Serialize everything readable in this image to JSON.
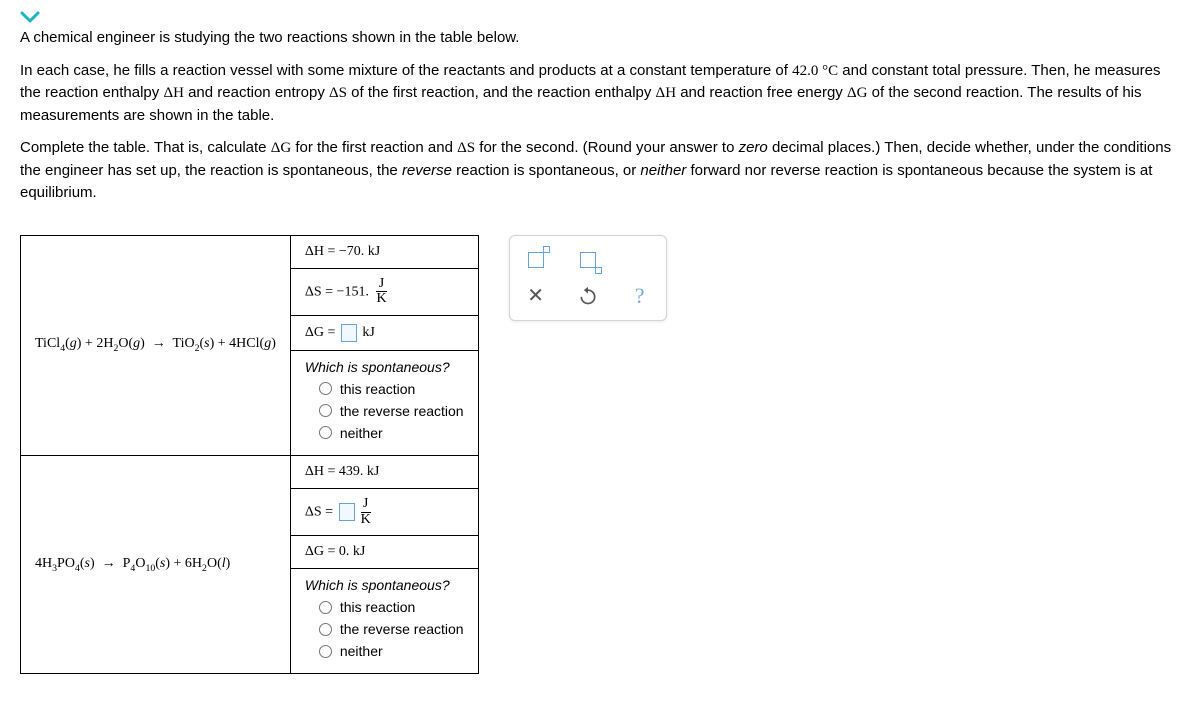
{
  "intro": {
    "line1_a": "A chemical engineer is studying the two reactions shown in the table below.",
    "line2_a": "In each case, he fills a reaction vessel with some mixture of the reactants and products at a constant temperature of ",
    "line2_temp": "42.0 °C",
    "line2_b": " and constant total pressure. Then, he measures the reaction enthalpy ",
    "dH": "ΔH",
    "line2_c": " and reaction entropy ",
    "dS": "ΔS",
    "line2_d": " of the first reaction, and the reaction enthalpy ",
    "line2_e": " and reaction free energy ",
    "dG": "ΔG",
    "line2_f": " of the second reaction. The results of his measurements are shown in the table.",
    "line3_a": "Complete the table. That is, calculate ",
    "line3_b": " for the first reaction and ",
    "line3_c": " for the second. (Round your answer to ",
    "zero": "zero",
    "line3_d": " decimal places.) Then, decide whether, under the conditions the engineer has set up, the reaction is spontaneous, the ",
    "reverse": "reverse",
    "line3_e": " reaction is spontaneous, or ",
    "neither": "neither",
    "line3_f": " forward nor reverse reaction is spontaneous because the system is at equilibrium."
  },
  "table": {
    "r1": {
      "dH_label": "ΔH",
      "dH_eq": " = −70. kJ",
      "dS_label": "ΔS",
      "dS_eq": " = −151. ",
      "frac_num": "J",
      "frac_den": "K",
      "dG_label": "ΔG",
      "dG_eq_pre": " = ",
      "dG_unit": " kJ",
      "spont_q": "Which is spontaneous?",
      "opt1": "this reaction",
      "opt2": "the reverse reaction",
      "opt3": "neither"
    },
    "r2": {
      "dH_label": "ΔH",
      "dH_eq": " = 439. kJ",
      "dS_label": "ΔS",
      "dS_eq_pre": " = ",
      "frac_num": "J",
      "frac_den": "K",
      "dG_label": "ΔG",
      "dG_eq": " = 0. kJ",
      "spont_q": "Which is spontaneous?",
      "opt1": "this reaction",
      "opt2": "the reverse reaction",
      "opt3": "neither"
    }
  },
  "toolbox": {
    "sup": "superscript",
    "sub": "subscript",
    "clear": "clear",
    "undo": "undo",
    "help": "help"
  }
}
